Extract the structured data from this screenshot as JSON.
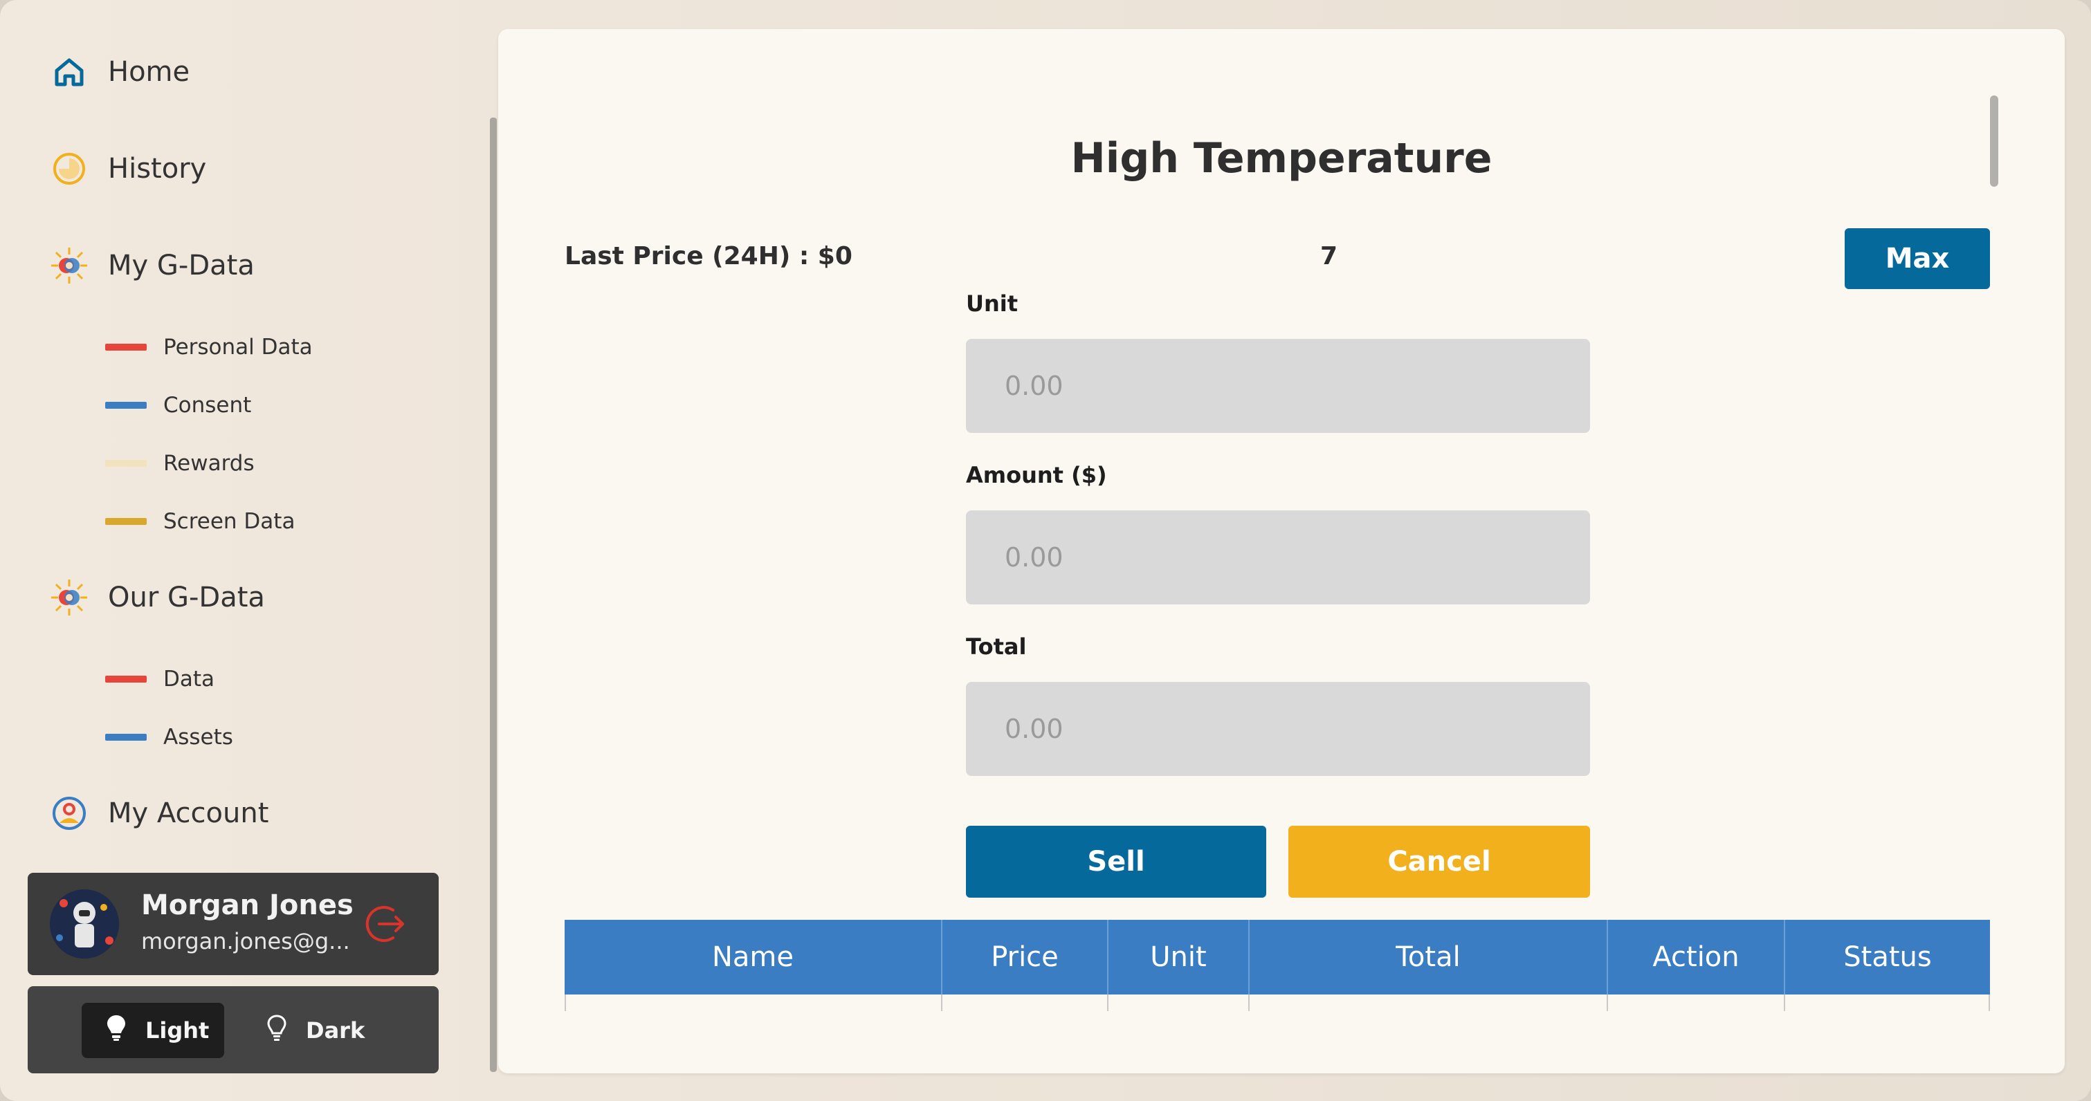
{
  "sidebar": {
    "nav": {
      "home": "Home",
      "history": "History",
      "my_gdata": "My G-Data",
      "our_gdata": "Our G-Data",
      "my_account": "My Account"
    },
    "my_gdata_items": [
      {
        "label": "Personal Data",
        "color": "#e8453a"
      },
      {
        "label": "Consent",
        "color": "#3b7dc3"
      },
      {
        "label": "Rewards",
        "color": "#f2e2bd"
      },
      {
        "label": "Screen Data",
        "color": "#d9a72c"
      }
    ],
    "our_gdata_items": [
      {
        "label": "Data",
        "color": "#e8453a"
      },
      {
        "label": "Assets",
        "color": "#3b7dc3"
      }
    ],
    "user": {
      "name": "Morgan Jones",
      "email": "morgan.jones@g..."
    },
    "theme": {
      "light_label": "Light",
      "dark_label": "Dark",
      "selected": "Light"
    }
  },
  "modal": {
    "title": "High Temperature",
    "last_price": "Last Price (24H) : $0",
    "count": "7",
    "max_label": "Max",
    "unit_label": "Unit",
    "unit_placeholder": "0.00",
    "amount_label": "Amount ($)",
    "amount_placeholder": "0.00",
    "total_label": "Total",
    "total_placeholder": "0.00",
    "sell_label": "Sell",
    "cancel_label": "Cancel",
    "table": {
      "columns": [
        "Name",
        "Price",
        "Unit",
        "Total",
        "Action",
        "Status"
      ]
    }
  },
  "colors": {
    "primary": "#05699c",
    "accent": "#f1b01c",
    "table_header": "#3b7dc3"
  }
}
